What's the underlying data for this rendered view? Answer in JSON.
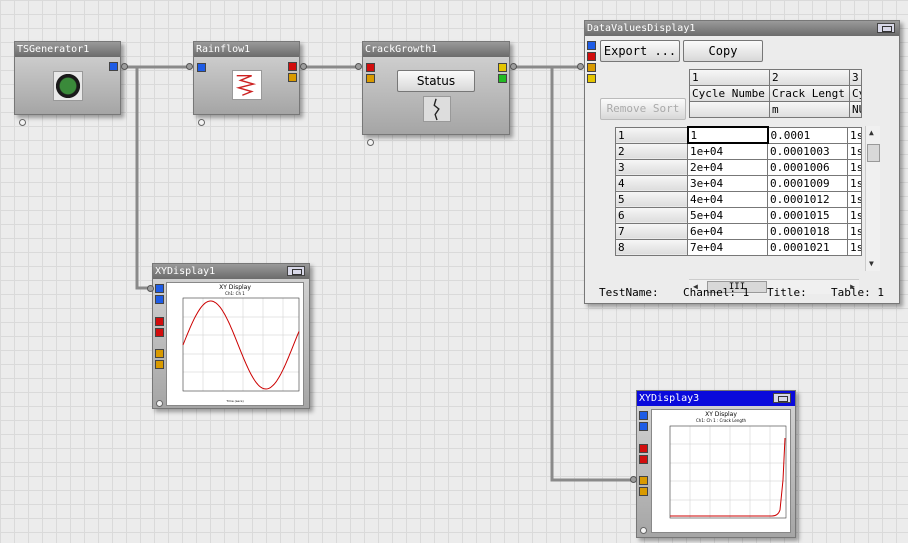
{
  "glyphs": {
    "ts_generator": {
      "title": "TSGenerator1"
    },
    "rainflow": {
      "title": "Rainflow1"
    },
    "crack_growth": {
      "title": "CrackGrowth1",
      "status_label": "Status"
    },
    "xy_display1": {
      "title": "XYDisplay1",
      "plot_title": "XY Display",
      "plot_subtitle": "Ch1: Ch 1",
      "xlabel": "Time (secs)"
    },
    "xy_display3": {
      "title": "XYDisplay3",
      "plot_title": "XY Display",
      "plot_subtitle": "Ch1: Ch 1 : Crack Length"
    },
    "data_values": {
      "title": "DataValuesDisplay1",
      "export_label": "Export ...",
      "copy_label": "Copy",
      "remove_sort_label": "Remove Sort",
      "col_numbers": [
        "1",
        "2",
        "3"
      ],
      "col_names": [
        "Cycle Numbe",
        "Crack Lengt",
        "Cy"
      ],
      "col_units": [
        "",
        "m",
        "NU"
      ],
      "rows": [
        {
          "idx": "1",
          "c1": "1",
          "c2": "0.0001",
          "c3": "1s"
        },
        {
          "idx": "2",
          "c1": "1e+04",
          "c2": "0.0001003",
          "c3": "1s"
        },
        {
          "idx": "3",
          "c1": "2e+04",
          "c2": "0.0001006",
          "c3": "1s"
        },
        {
          "idx": "4",
          "c1": "3e+04",
          "c2": "0.0001009",
          "c3": "1s"
        },
        {
          "idx": "5",
          "c1": "4e+04",
          "c2": "0.0001012",
          "c3": "1s"
        },
        {
          "idx": "6",
          "c1": "5e+04",
          "c2": "0.0001015",
          "c3": "1s"
        },
        {
          "idx": "7",
          "c1": "6e+04",
          "c2": "0.0001018",
          "c3": "1s"
        },
        {
          "idx": "8",
          "c1": "7e+04",
          "c2": "0.0001021",
          "c3": "1s"
        }
      ],
      "status": {
        "testname": "TestName:",
        "channel": "Channel: 1",
        "title": "Title:",
        "table": "Table: 1"
      },
      "hscroll_grip": "III"
    }
  },
  "colors": {
    "port_blue": "#1e5ce6",
    "port_red": "#d20d0d",
    "port_orange": "#d99a00",
    "port_green": "#22bb22",
    "curve": "#cc0000",
    "active_title": "#0a0adc"
  }
}
